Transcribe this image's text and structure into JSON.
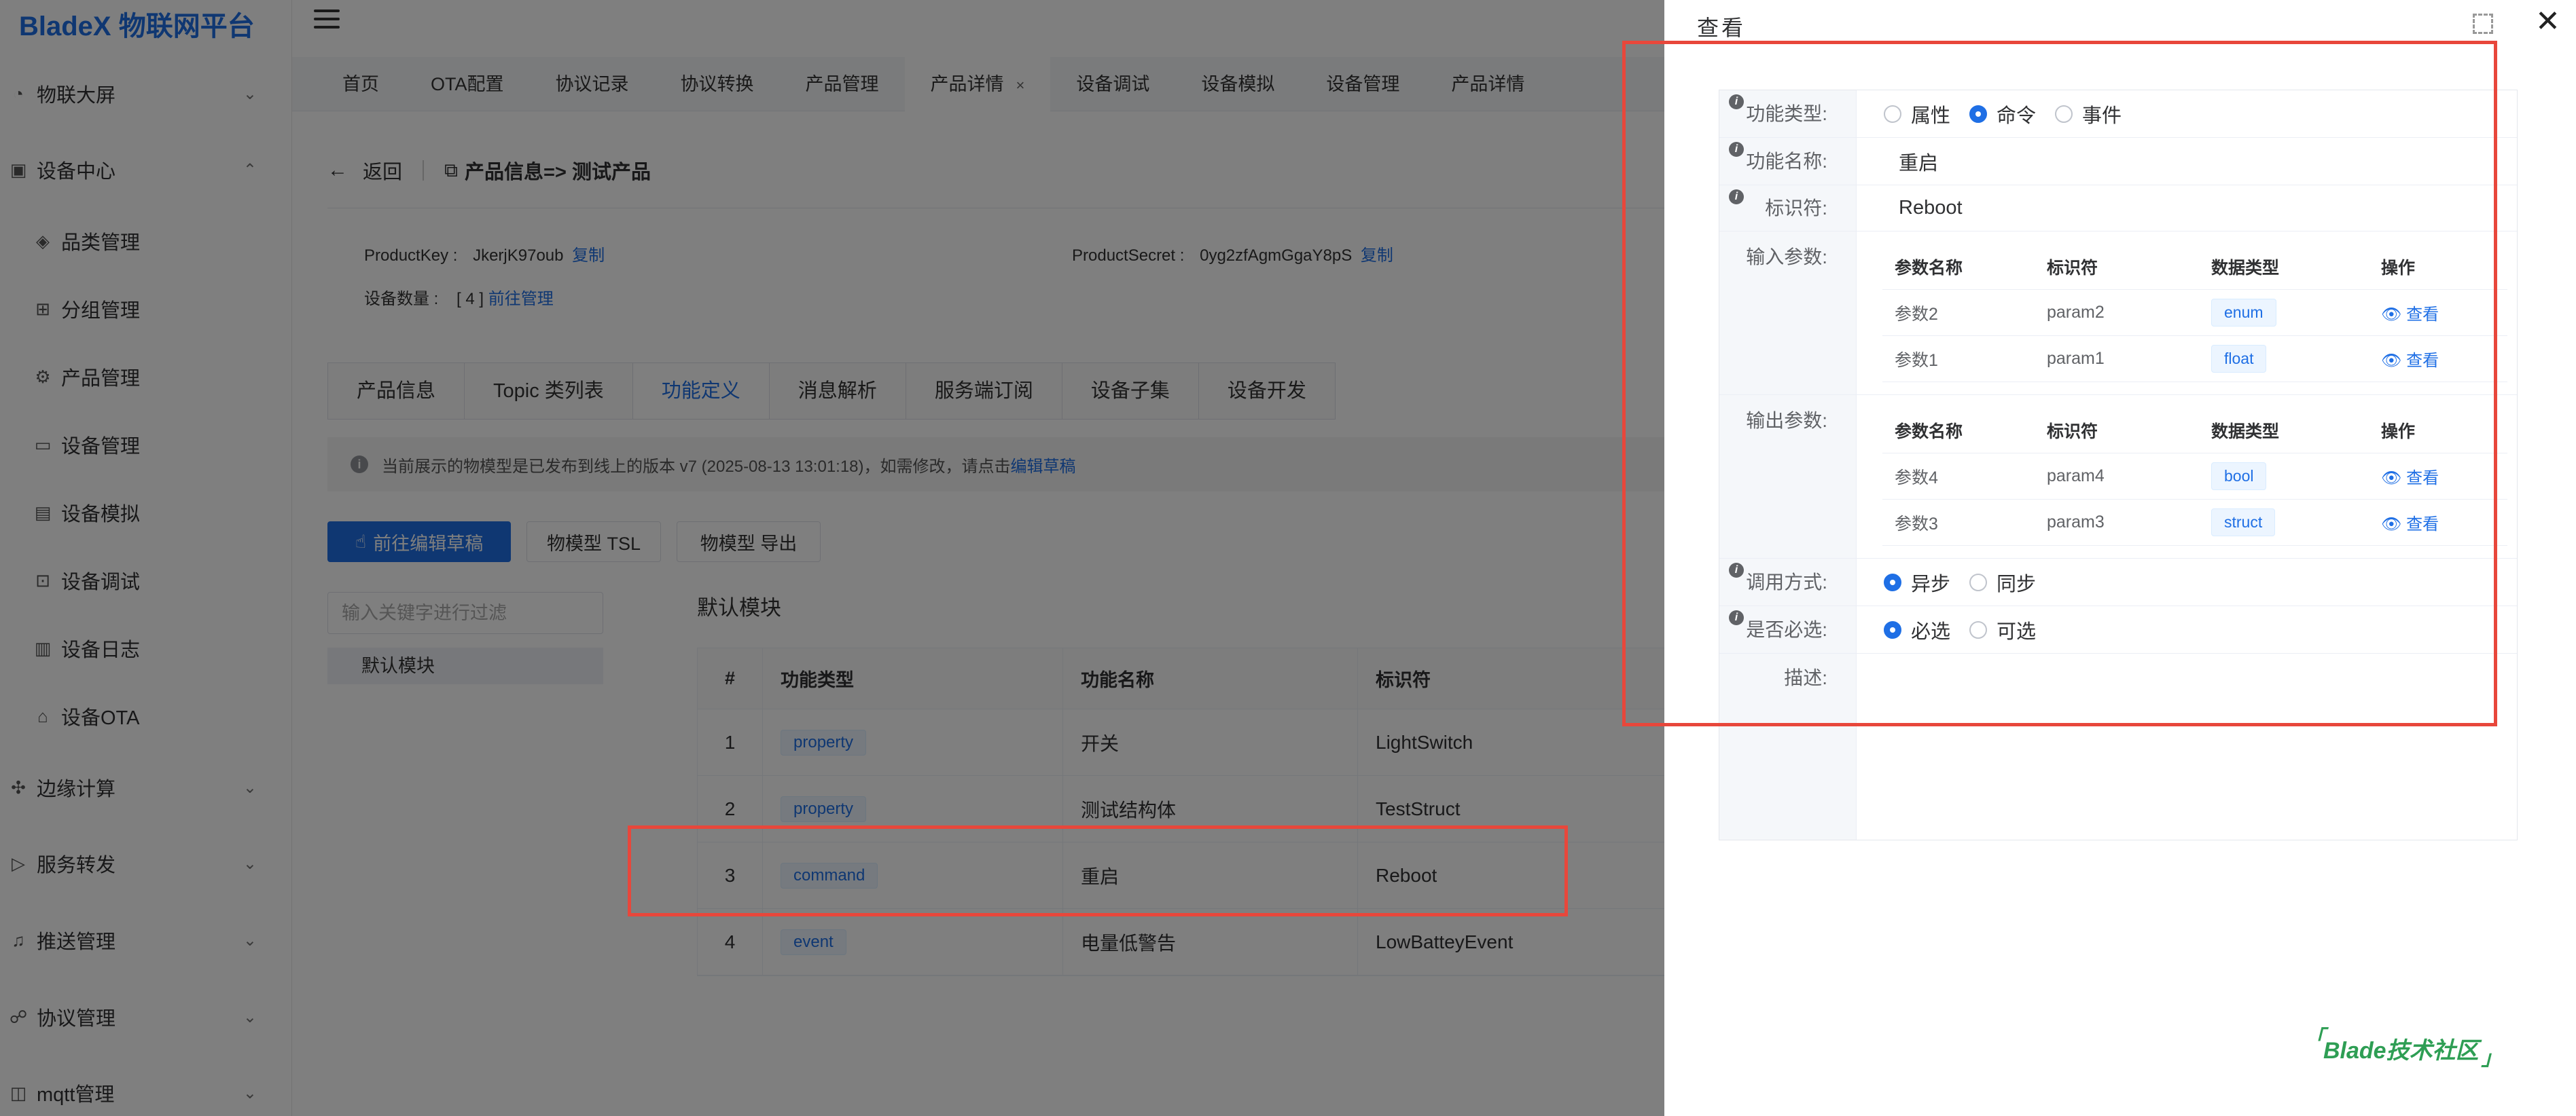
{
  "app": {
    "brand": "BladeX 物联网平台"
  },
  "sidebar": {
    "items": [
      {
        "label": "物联大屏",
        "icon": "dashboard-icon",
        "chev": "⌄"
      },
      {
        "label": "设备中心",
        "icon": "device-center-icon",
        "chev": "⌃"
      },
      {
        "label": "品类管理",
        "icon": "cube-icon",
        "chev": ""
      },
      {
        "label": "分组管理",
        "icon": "group-icon",
        "chev": ""
      },
      {
        "label": "产品管理",
        "icon": "product-icon",
        "chev": ""
      },
      {
        "label": "设备管理",
        "icon": "monitor-icon",
        "chev": ""
      },
      {
        "label": "设备模拟",
        "icon": "simulate-icon",
        "chev": ""
      },
      {
        "label": "设备调试",
        "icon": "debug-icon",
        "chev": ""
      },
      {
        "label": "设备日志",
        "icon": "log-icon",
        "chev": ""
      },
      {
        "label": "设备OTA",
        "icon": "ota-icon",
        "chev": ""
      },
      {
        "label": "边缘计算",
        "icon": "edge-icon",
        "chev": "⌄"
      },
      {
        "label": "服务转发",
        "icon": "forward-icon",
        "chev": "⌄"
      },
      {
        "label": "推送管理",
        "icon": "bell-icon",
        "chev": "⌄"
      },
      {
        "label": "协议管理",
        "icon": "protocol-icon",
        "chev": "⌄"
      },
      {
        "label": "mqtt管理",
        "icon": "mqtt-icon",
        "chev": "⌄"
      }
    ]
  },
  "tabs": [
    {
      "label": "首页"
    },
    {
      "label": "OTA配置"
    },
    {
      "label": "协议记录"
    },
    {
      "label": "协议转换"
    },
    {
      "label": "产品管理"
    },
    {
      "label": "产品详情",
      "close": "×"
    },
    {
      "label": "设备调试"
    },
    {
      "label": "设备模拟"
    },
    {
      "label": "设备管理"
    },
    {
      "label": "产品详情"
    }
  ],
  "page": {
    "back_label": "返回",
    "title": "产品信息=> 测试产品",
    "product_key_label": "ProductKey :",
    "product_key": "JkerjK97oub",
    "copy_label": "复制",
    "product_secret_label": "ProductSecret :",
    "product_secret": "0yg2zfAgmGgaY8pS",
    "device_count_label": "设备数量 :",
    "device_count": "[ 4 ]",
    "goto_manage": "前往管理"
  },
  "ptabs": [
    {
      "label": "产品信息"
    },
    {
      "label": "Topic 类列表"
    },
    {
      "label": "功能定义"
    },
    {
      "label": "消息解析"
    },
    {
      "label": "服务端订阅"
    },
    {
      "label": "设备子集"
    },
    {
      "label": "设备开发"
    }
  ],
  "notice": {
    "text": "当前展示的物模型是已发布到线上的版本 v7 (2025-08-13 13:01:18)，如需修改，请点击",
    "link": "编辑草稿"
  },
  "actions": {
    "edit_draft": "前往编辑草稿",
    "tsl": "物模型 TSL",
    "export": "物模型 导出"
  },
  "filter": {
    "placeholder": "输入关键字进行过滤"
  },
  "module": {
    "left_item": "默认模块",
    "title": "默认模块"
  },
  "functions": {
    "headers": [
      "#",
      "功能类型",
      "功能名称",
      "标识符"
    ],
    "rows": [
      {
        "no": "1",
        "type": "property",
        "name": "开关",
        "id": "LightSwitch"
      },
      {
        "no": "2",
        "type": "property",
        "name": "测试结构体",
        "id": "TestStruct"
      },
      {
        "no": "3",
        "type": "command",
        "name": "重启",
        "id": "Reboot"
      },
      {
        "no": "4",
        "type": "event",
        "name": "电量低警告",
        "id": "LowBatteyEvent"
      }
    ]
  },
  "drawer": {
    "title": "查看",
    "func_type_label": "功能类型:",
    "func_types": [
      "属性",
      "命令",
      "事件"
    ],
    "func_type_selected": "命令",
    "func_name_label": "功能名称:",
    "func_name": "重启",
    "identifier_label": "标识符:",
    "identifier": "Reboot",
    "input_label": "输入参数:",
    "output_label": "输出参数:",
    "param_headers": [
      "参数名称",
      "标识符",
      "数据类型",
      "操作"
    ],
    "view_label": "查看",
    "inputs": [
      {
        "name": "参数2",
        "id": "param2",
        "type": "enum"
      },
      {
        "name": "参数1",
        "id": "param1",
        "type": "float"
      }
    ],
    "outputs": [
      {
        "name": "参数4",
        "id": "param4",
        "type": "bool"
      },
      {
        "name": "参数3",
        "id": "param3",
        "type": "struct"
      }
    ],
    "call_label": "调用方式:",
    "call_options": [
      "异步",
      "同步"
    ],
    "required_label": "是否必选:",
    "required_options": [
      "必选",
      "可选"
    ],
    "desc_label": "描述:"
  },
  "watermark": "Blade技术社区"
}
